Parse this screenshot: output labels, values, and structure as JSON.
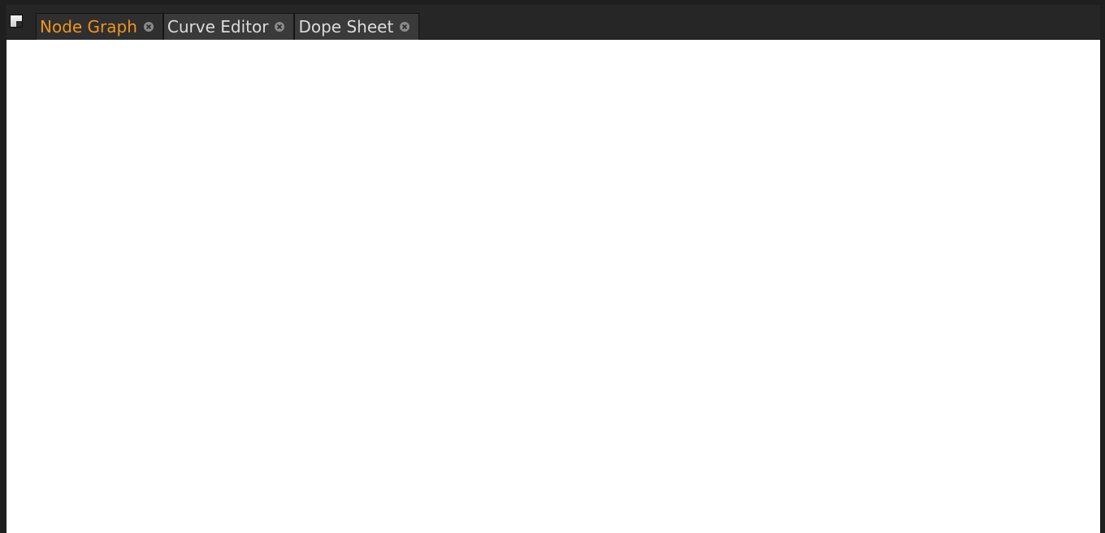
{
  "panel": {
    "tabs": [
      {
        "label": "Node Graph",
        "active": true
      },
      {
        "label": "Curve Editor",
        "active": false
      },
      {
        "label": "Dope Sheet",
        "active": false
      }
    ],
    "menu_icon": "panel-menu-icon",
    "close_icon": "close-circle-icon"
  },
  "colors": {
    "active_tab_text": "#f0951d",
    "tab_text": "#dcdcdc",
    "tab_bg": "#3a3a3a",
    "bar_bg": "#262626",
    "content_bg": "#ffffff"
  }
}
